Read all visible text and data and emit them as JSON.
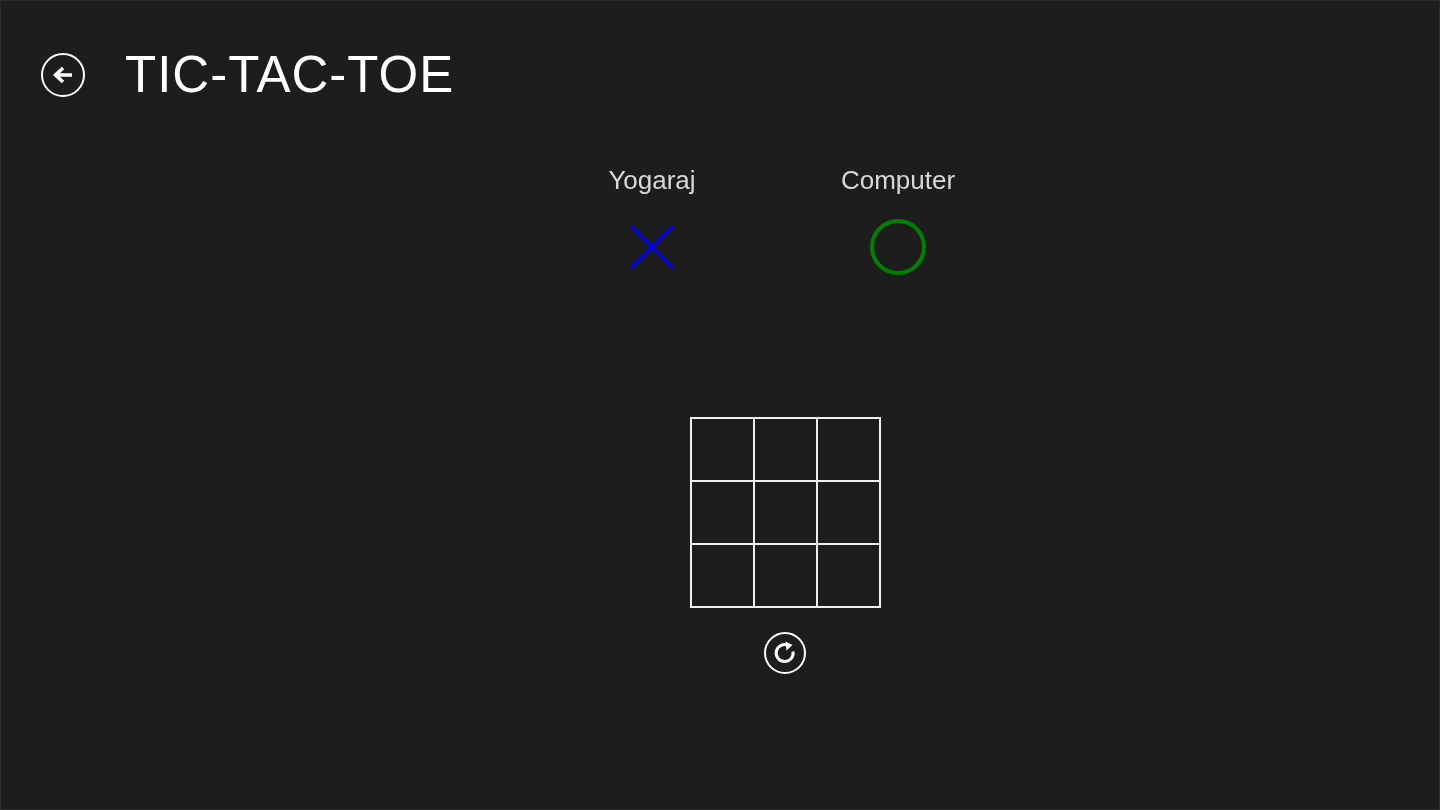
{
  "header": {
    "title": "TIC-TAC-TOE"
  },
  "players": [
    {
      "name": "Yogaraj",
      "kind": "cross",
      "color": "#0000ff"
    },
    {
      "name": "Computer",
      "kind": "ring",
      "color": "#008000"
    }
  ]
}
